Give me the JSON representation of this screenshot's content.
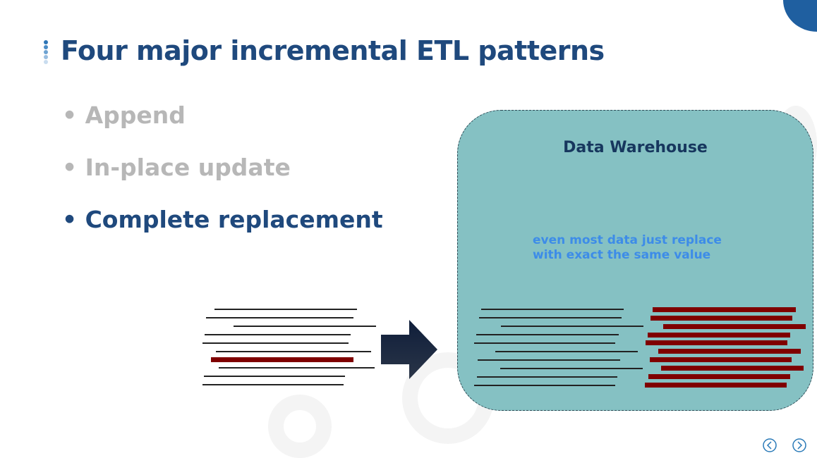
{
  "slide": {
    "title": "Four major incremental ETL patterns",
    "bullets": [
      {
        "label": "Append",
        "active": false
      },
      {
        "label": "In-place update",
        "active": false
      },
      {
        "label": "Complete replacement",
        "active": true
      }
    ],
    "warehouse_label": "Data Warehouse",
    "note_lines": [
      "even most data just replace",
      "with exact the same value"
    ]
  },
  "colors": {
    "title": "#1f497d",
    "inactive": "#b7b7b7",
    "warehouse_fill": "#85c1c3",
    "changed_row": "#7f0000",
    "note": "#3d8ce8"
  },
  "nav": {
    "prev_icon": "chevron-left-icon",
    "next_icon": "chevron-right-icon"
  }
}
